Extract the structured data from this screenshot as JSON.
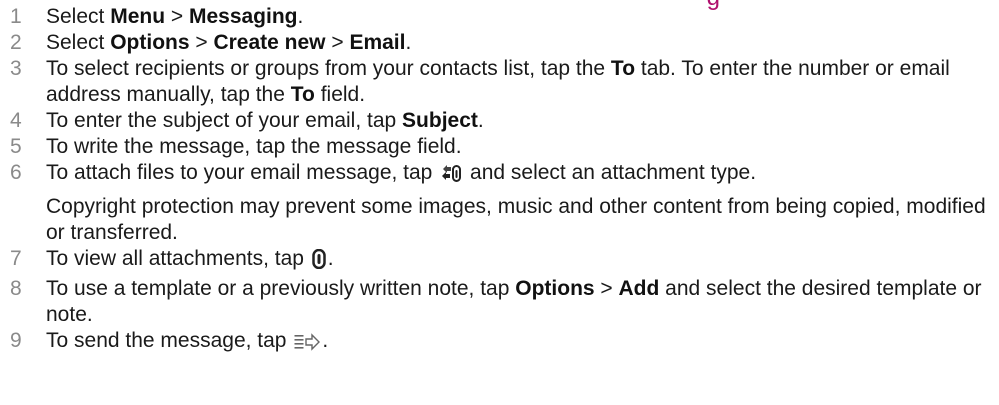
{
  "heading": {
    "visible_fragment": "g"
  },
  "steps": [
    {
      "num": "1",
      "t1": "Select ",
      "b1": "Menu",
      "t2": " > ",
      "b2": "Messaging",
      "t3": "."
    },
    {
      "num": "2",
      "t1": "Select ",
      "b1": "Options",
      "t2": " > ",
      "b2": "Create new",
      "t3": " > ",
      "b3": "Email",
      "t4": "."
    },
    {
      "num": "3",
      "t1": "To select recipients or groups from your contacts list, tap the ",
      "b1": "To",
      "t2": " tab. To enter the number or email address manually, tap the ",
      "b2": "To",
      "t3": " field."
    },
    {
      "num": "4",
      "t1": "To enter the subject of your email, tap ",
      "b1": "Subject",
      "t2": "."
    },
    {
      "num": "5",
      "t1": "To write the message, tap the message field."
    },
    {
      "num": "6",
      "t1": "To attach files to your email message, tap ",
      "t2": " and select an attachment type.",
      "icon": "add-attachment-icon",
      "note": "Copyright protection may prevent some images, music and other content from being copied, modified or transferred."
    },
    {
      "num": "7",
      "t1": "To view all attachments, tap ",
      "t2": ".",
      "icon": "attachments-icon"
    },
    {
      "num": "8",
      "t1": "To use a template or a previously written note, tap ",
      "b1": "Options",
      "t2": " > ",
      "b2": "Add",
      "t3": " and select the desired template or note."
    },
    {
      "num": "9",
      "t1": "To send the message, tap ",
      "t2": ".",
      "icon": "send-icon"
    }
  ],
  "colors": {
    "heading": "#b0106e",
    "step_number": "#8a8a8a",
    "text": "#1a1a1a"
  }
}
